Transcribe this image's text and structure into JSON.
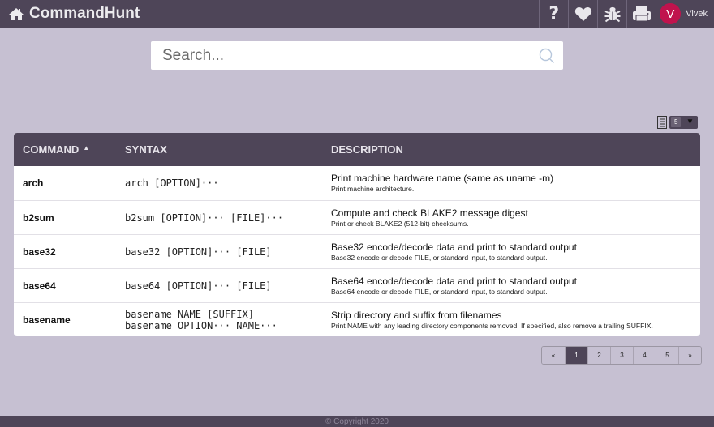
{
  "app": {
    "title": "CommandHunt"
  },
  "user": {
    "initial": "V",
    "name": "Vivek"
  },
  "search": {
    "placeholder": "Search...",
    "value": ""
  },
  "page_size": {
    "value": "5"
  },
  "table": {
    "columns": [
      "COMMAND",
      "SYNTAX",
      "DESCRIPTION"
    ],
    "rows": [
      {
        "command": "arch",
        "syntax": [
          "arch [OPTION]···"
        ],
        "desc": "Print machine hardware name (same as uname -m)",
        "sub": "Print machine architecture."
      },
      {
        "command": "b2sum",
        "syntax": [
          "b2sum [OPTION]··· [FILE]···"
        ],
        "desc": "Compute and check BLAKE2 message digest",
        "sub": "Print or check BLAKE2 (512-bit) checksums."
      },
      {
        "command": "base32",
        "syntax": [
          "base32 [OPTION]··· [FILE]"
        ],
        "desc": "Base32 encode/decode data and print to standard output",
        "sub": "Base32 encode or decode FILE, or standard input, to standard output."
      },
      {
        "command": "base64",
        "syntax": [
          "base64 [OPTION]··· [FILE]"
        ],
        "desc": "Base64 encode/decode data and print to standard output",
        "sub": "Base64 encode or decode FILE, or standard input, to standard output."
      },
      {
        "command": "basename",
        "syntax": [
          "basename NAME [SUFFIX]",
          "basename OPTION··· NAME···"
        ],
        "desc": "Strip directory and suffix from filenames",
        "sub": "Print NAME with any leading directory components removed. If specified, also remove a trailing SUFFIX."
      }
    ]
  },
  "pagination": {
    "prev": "«",
    "pages": [
      "1",
      "2",
      "3",
      "4",
      "5"
    ],
    "active": "1",
    "next": "»"
  },
  "footer": {
    "text": "© Copyright 2020"
  }
}
